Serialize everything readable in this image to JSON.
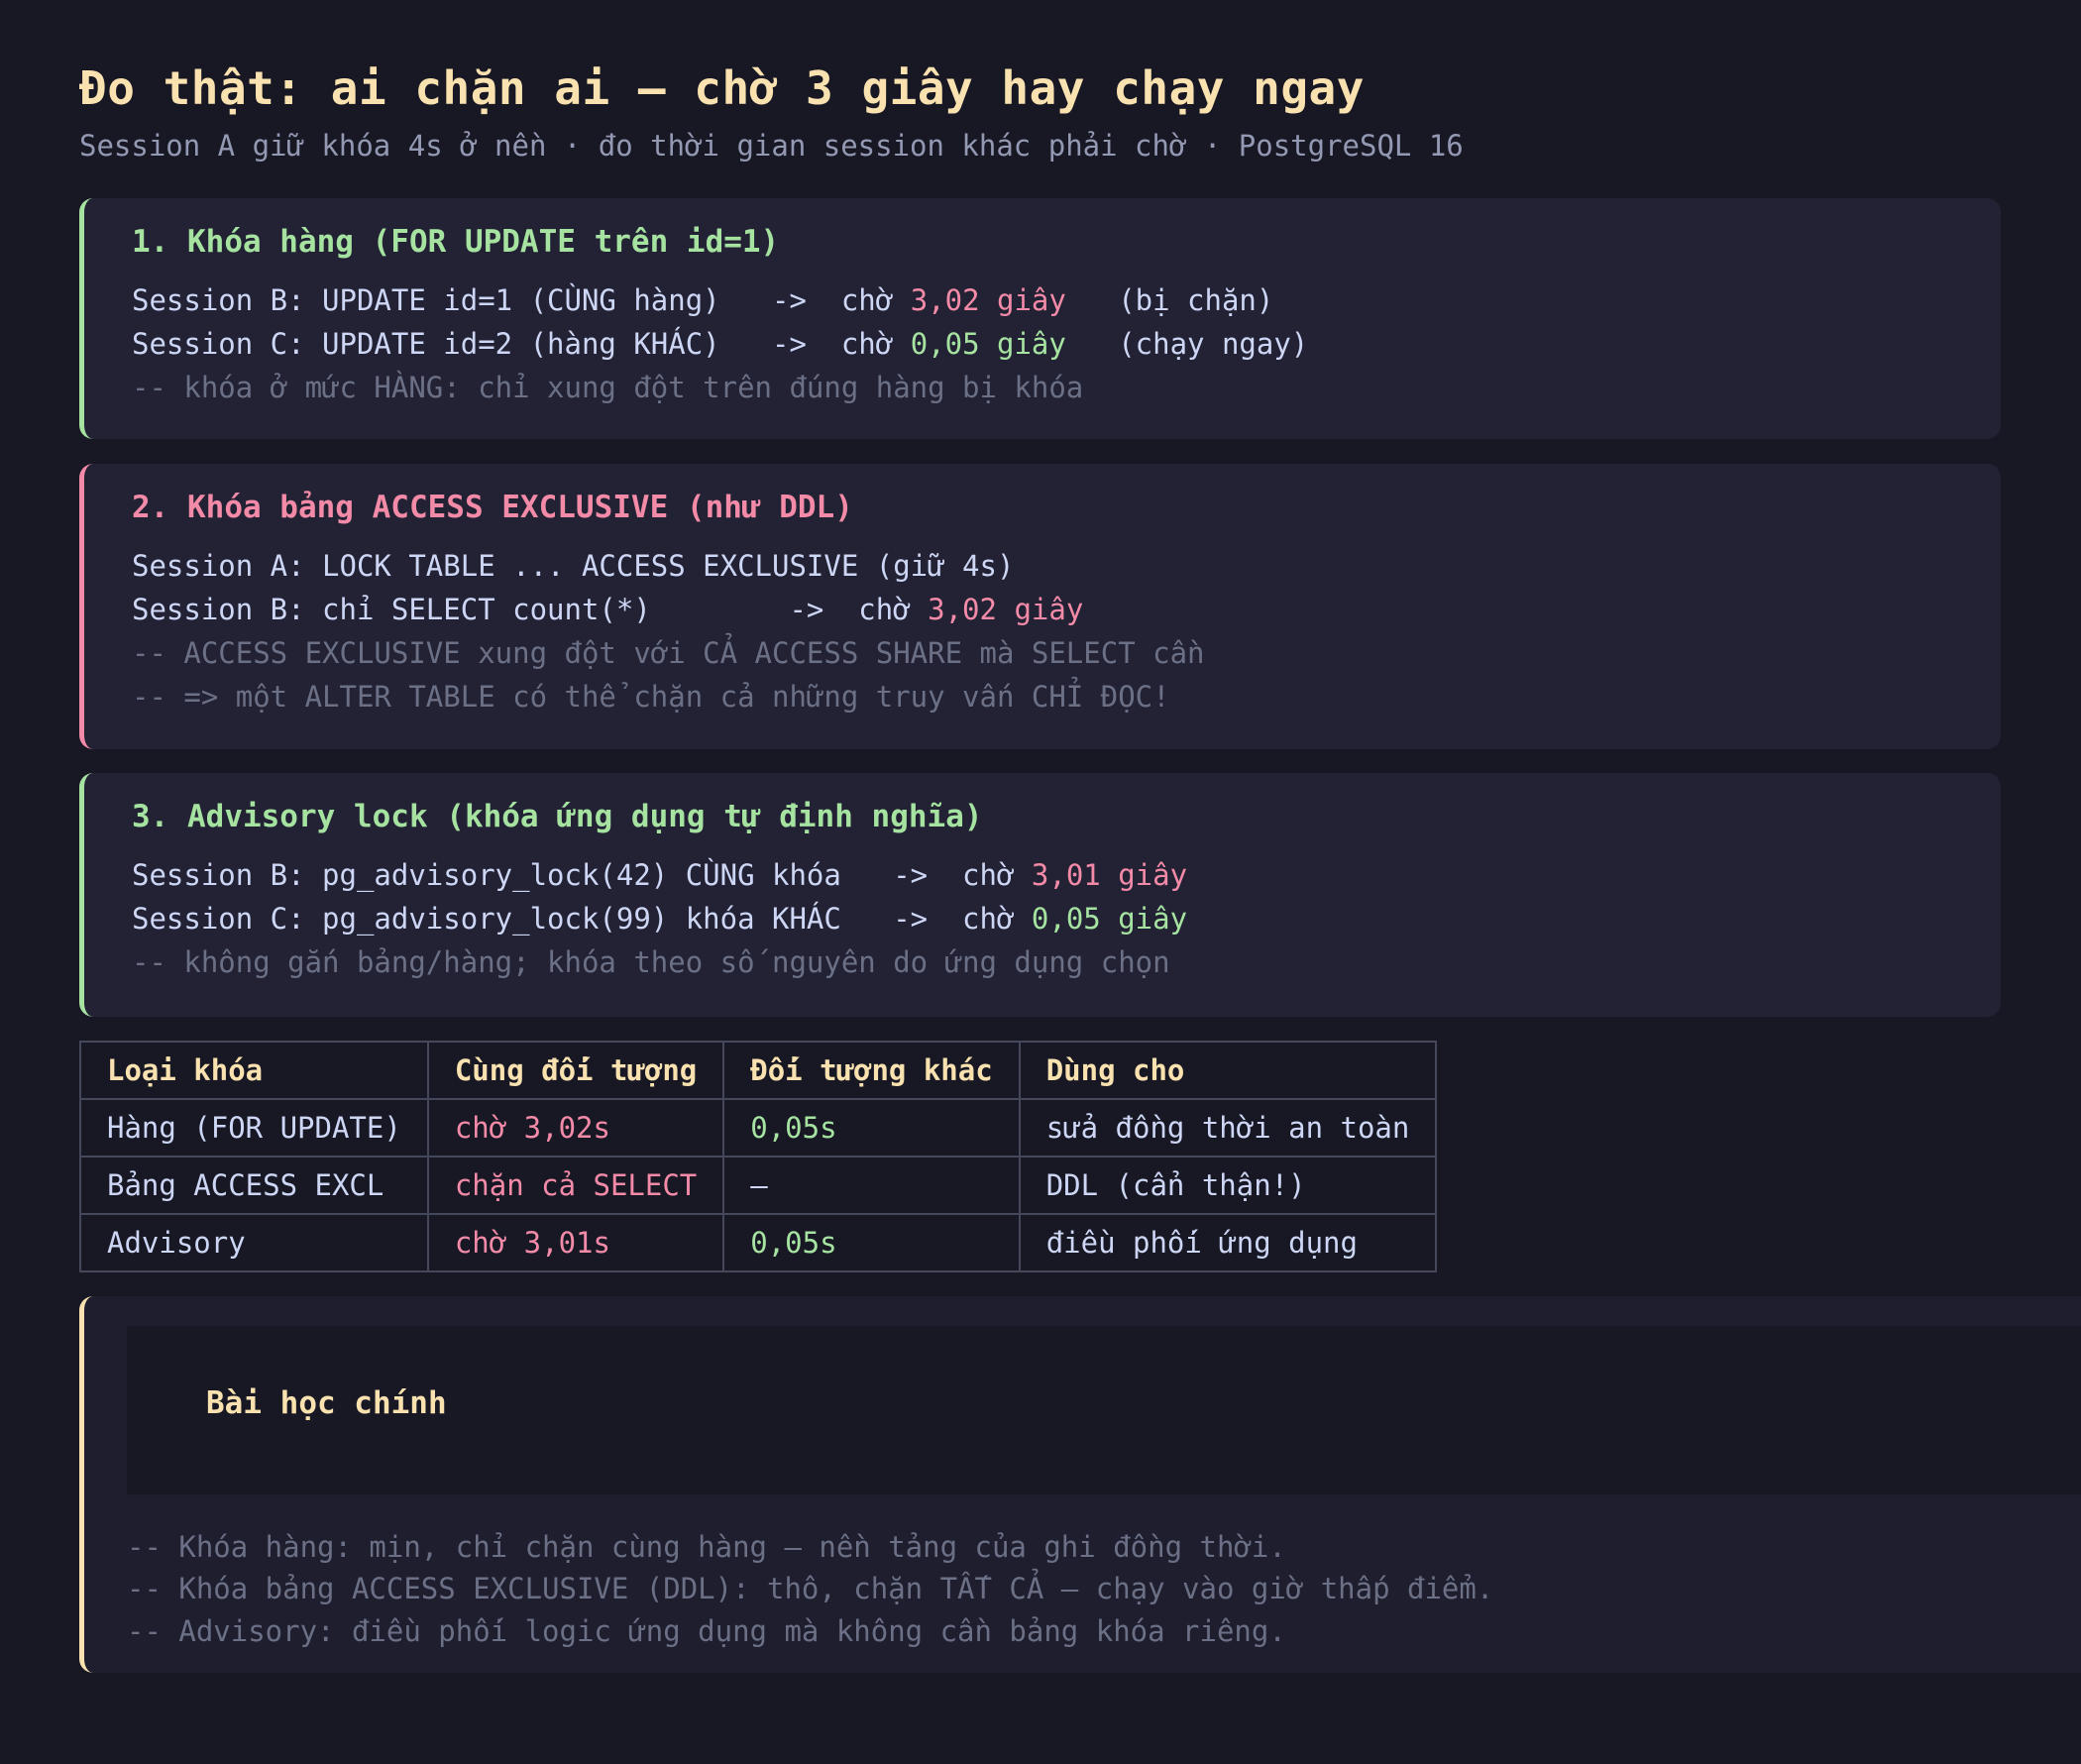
{
  "header": {
    "title": "Đo thật: ai chặn ai — chờ 3 giây hay chạy ngay",
    "subtitle": "Session A giữ khóa 4s ở nền · đo thời gian session khác phải chờ · PostgreSQL 16"
  },
  "colors": {
    "background": "#181825",
    "card": "#222234",
    "title": "#f9e2af",
    "blocked": "#f38ba8",
    "immediate": "#a6e3a1",
    "comment": "#6c7086"
  },
  "cards": [
    {
      "title": "1. Khóa hàng (FOR UPDATE trên id=1)",
      "lines": [
        {
          "prefix": "Session B: UPDATE id=1 (CÙNG hàng)   ->  chờ ",
          "value": "3,02 giây",
          "suffix": "   (bị chặn)"
        },
        {
          "prefix": "Session C: UPDATE id=2 (hàng KHÁC)   ->  chờ ",
          "value": "0,05 giây",
          "suffix": "   (chạy ngay)"
        }
      ],
      "comments": [
        "-- khóa ở mức HÀNG: chỉ xung đột trên đúng hàng bị khóa"
      ]
    },
    {
      "title": "2. Khóa bảng ACCESS EXCLUSIVE (như DDL)",
      "lines": [
        {
          "text": "Session A: LOCK TABLE ... ACCESS EXCLUSIVE (giữ 4s)"
        },
        {
          "prefix": "Session B: chỉ SELECT count(*)        ->  chờ ",
          "value": "3,02 giây"
        }
      ],
      "comments": [
        "-- ACCESS EXCLUSIVE xung đột với CẢ ACCESS SHARE mà SELECT cần",
        "-- => một ALTER TABLE có thể chặn cả những truy vấn CHỈ ĐỌC!"
      ]
    },
    {
      "title": "3. Advisory lock (khóa ứng dụng tự định nghĩa)",
      "lines": [
        {
          "prefix": "Session B: pg_advisory_lock(42) CÙNG khóa   ->  chờ ",
          "value": "3,01 giây"
        },
        {
          "prefix": "Session C: pg_advisory_lock(99) khóa KHÁC   ->  chờ ",
          "value": "0,05 giây"
        }
      ],
      "comments": [
        "-- không gắn bảng/hàng; khóa theo số nguyên do ứng dụng chọn"
      ]
    }
  ],
  "table": {
    "headers": [
      "Loại khóa",
      "Cùng đối tượng",
      "Đối tượng khác",
      "Dùng cho"
    ],
    "rows": [
      [
        "Hàng (FOR UPDATE)",
        "chờ 3,02s",
        "0,05s",
        "sửa đồng thời an toàn"
      ],
      [
        "Bảng ACCESS EXCL",
        "chặn cả SELECT",
        "—",
        "DDL (cẩn thận!)"
      ],
      [
        "Advisory",
        "chờ 3,01s",
        "0,05s",
        "điều phối ứng dụng"
      ]
    ]
  },
  "lesson": {
    "title": "Bài học chính",
    "lines": [
      "-- Khóa hàng: mịn, chỉ chặn cùng hàng — nền tảng của ghi đồng thời.",
      "-- Khóa bảng ACCESS EXCLUSIVE (DDL): thô, chặn TẤT CẢ — chạy vào giờ thấp điểm.",
      "-- Advisory: điều phối logic ứng dụng mà không cần bảng khóa riêng."
    ]
  }
}
